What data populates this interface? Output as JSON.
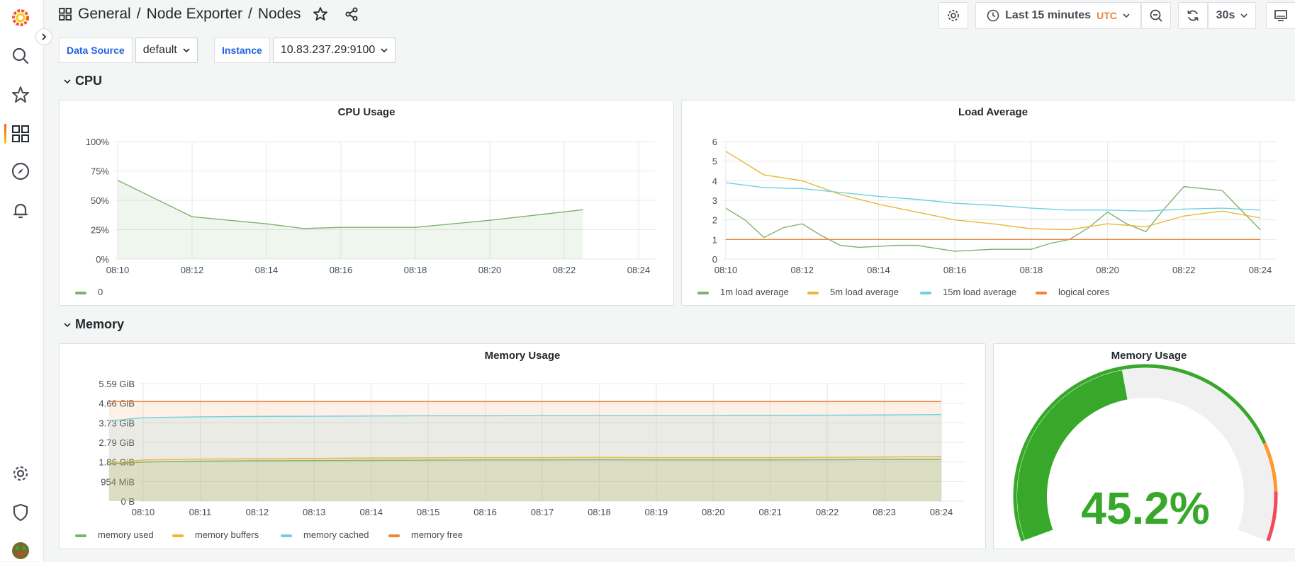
{
  "breadcrumb": {
    "folder": "General",
    "sep1": "/",
    "part2": "Node Exporter",
    "sep2": "/",
    "part3": "Nodes"
  },
  "toolbar": {
    "time_range": "Last 15 minutes",
    "timezone": "UTC",
    "refresh_interval": "30s"
  },
  "variables": [
    {
      "label": "Data Source",
      "value": "default"
    },
    {
      "label": "Instance",
      "value": "10.83.237.29:9100"
    }
  ],
  "rows": {
    "cpu": "CPU",
    "memory": "Memory"
  },
  "colors": {
    "green": "#7eb26d",
    "yellow": "#eab839",
    "blue": "#6ed0e0",
    "orange": "#ef843c",
    "gauge_green": "#37a82a",
    "gauge_orange": "#ff9830",
    "gauge_red": "#f2495c",
    "accent": "#f05a28"
  },
  "chart_data": [
    {
      "type": "area",
      "title": "CPU Usage",
      "x": [
        "08:10",
        "08:12",
        "08:14",
        "08:15",
        "08:16",
        "08:18",
        "08:20",
        "08:22.5"
      ],
      "x_ticks": [
        "08:10",
        "08:12",
        "08:14",
        "08:16",
        "08:18",
        "08:20",
        "08:22",
        "08:24"
      ],
      "y_ticks": [
        "0%",
        "25%",
        "50%",
        "75%",
        "100%"
      ],
      "ylim": [
        0,
        100
      ],
      "series": [
        {
          "name": "0",
          "color": "#7eb26d",
          "values": [
            67,
            36,
            30,
            26,
            27,
            27,
            33,
            42
          ]
        }
      ]
    },
    {
      "type": "line",
      "title": "Load Average",
      "x_ticks": [
        "08:10",
        "08:12",
        "08:14",
        "08:16",
        "08:18",
        "08:20",
        "08:22",
        "08:24"
      ],
      "y_ticks": [
        "0",
        "1",
        "2",
        "3",
        "4",
        "5",
        "6"
      ],
      "ylim": [
        0,
        6
      ],
      "series": [
        {
          "name": "1m load average",
          "color": "#7eb26d",
          "x": [
            0,
            0.5,
            1,
            1.5,
            2,
            2.5,
            3,
            3.5,
            4,
            4.5,
            5,
            5.5,
            6,
            6.5,
            7,
            7.5,
            8,
            8.5,
            9,
            9.5,
            10,
            10.5,
            11,
            11.5,
            12,
            12.5,
            13,
            13.5,
            14
          ],
          "values": [
            2.6,
            2.0,
            1.1,
            1.6,
            1.8,
            1.2,
            0.7,
            0.6,
            0.65,
            0.7,
            0.7,
            0.55,
            0.4,
            0.45,
            0.5,
            0.5,
            0.5,
            0.8,
            1.0,
            1.6,
            2.4,
            1.8,
            1.4,
            2.6,
            3.7,
            3.6,
            3.5,
            2.5,
            1.5
          ]
        },
        {
          "name": "5m load average",
          "color": "#eab839",
          "x": [
            0,
            1,
            2,
            3,
            4,
            5,
            6,
            7,
            8,
            9,
            10,
            11,
            12,
            13,
            14
          ],
          "values": [
            5.5,
            4.3,
            4.0,
            3.3,
            2.8,
            2.4,
            2.0,
            1.8,
            1.55,
            1.5,
            1.8,
            1.65,
            2.2,
            2.45,
            2.1
          ]
        },
        {
          "name": "15m load average",
          "color": "#6ed0e0",
          "x": [
            0,
            1,
            2,
            3,
            4,
            5,
            6,
            7,
            8,
            9,
            10,
            11,
            12,
            13,
            14
          ],
          "values": [
            3.9,
            3.65,
            3.6,
            3.4,
            3.2,
            3.05,
            2.85,
            2.75,
            2.6,
            2.5,
            2.5,
            2.45,
            2.55,
            2.6,
            2.5
          ]
        },
        {
          "name": "logical cores",
          "color": "#ef843c",
          "x": [
            0,
            14
          ],
          "values": [
            1,
            1
          ]
        }
      ]
    },
    {
      "type": "area",
      "title": "Memory Usage",
      "x_ticks": [
        "08:10",
        "08:11",
        "08:12",
        "08:13",
        "08:14",
        "08:15",
        "08:16",
        "08:17",
        "08:18",
        "08:19",
        "08:20",
        "08:21",
        "08:22",
        "08:23",
        "08:24"
      ],
      "y_ticks": [
        "0 B",
        "954 MiB",
        "1.86 GiB",
        "2.79 GiB",
        "3.73 GiB",
        "4.66 GiB",
        "5.59 GiB"
      ],
      "ylim": [
        0,
        5.59
      ],
      "series": [
        {
          "name": "memory used",
          "color": "#7eb26d",
          "x": [
            -0.6,
            -0.4,
            0,
            1,
            2,
            3,
            4,
            5,
            6,
            7,
            8,
            9,
            10,
            11,
            12,
            13,
            14
          ],
          "values": [
            1.78,
            1.8,
            1.86,
            1.9,
            1.92,
            1.93,
            1.94,
            1.95,
            1.96,
            1.96,
            1.97,
            1.96,
            1.96,
            1.96,
            1.97,
            1.98,
            1.99
          ]
        },
        {
          "name": "memory buffers",
          "color": "#eab839",
          "x": [
            -0.6,
            -0.4,
            0,
            1,
            2,
            3,
            4,
            5,
            6,
            7,
            8,
            9,
            10,
            11,
            12,
            13,
            14
          ],
          "values": [
            1.84,
            1.86,
            1.96,
            2.0,
            2.02,
            2.03,
            2.05,
            2.06,
            2.07,
            2.07,
            2.08,
            2.07,
            2.07,
            2.07,
            2.08,
            2.1,
            2.12
          ]
        },
        {
          "name": "memory cached",
          "color": "#6ed0e0",
          "x": [
            -0.6,
            -0.4,
            0,
            1,
            2,
            3,
            4,
            5,
            6,
            7,
            8,
            9,
            10,
            11,
            12,
            13,
            14
          ],
          "values": [
            3.83,
            3.86,
            3.97,
            4.01,
            4.03,
            4.04,
            4.05,
            4.06,
            4.06,
            4.07,
            4.07,
            4.07,
            4.07,
            4.08,
            4.09,
            4.1,
            4.12
          ]
        },
        {
          "name": "memory free",
          "color": "#ef843c",
          "x": [
            -0.6,
            14
          ],
          "values": [
            4.74,
            4.74
          ]
        }
      ]
    },
    {
      "type": "gauge",
      "title": "Memory Usage",
      "value": 45.2,
      "display": "45.2%",
      "thresholds": [
        {
          "from": 0,
          "to": 80,
          "color": "#37a82a"
        },
        {
          "from": 80,
          "to": 90,
          "color": "#ff9830"
        },
        {
          "from": 90,
          "to": 100,
          "color": "#f2495c"
        }
      ]
    }
  ]
}
